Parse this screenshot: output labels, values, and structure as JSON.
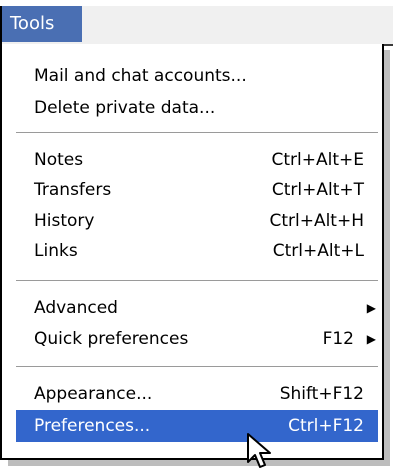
{
  "menubar": {
    "tools_label": "Tools"
  },
  "menu": {
    "items": [
      {
        "label": "Mail and chat accounts...",
        "shortcut": ""
      },
      {
        "label": "Delete private data...",
        "shortcut": ""
      },
      {
        "label": "Notes",
        "shortcut": "Ctrl+Alt+E"
      },
      {
        "label": "Transfers",
        "shortcut": "Ctrl+Alt+T"
      },
      {
        "label": "History",
        "shortcut": "Ctrl+Alt+H"
      },
      {
        "label": "Links",
        "shortcut": "Ctrl+Alt+L"
      },
      {
        "label": "Advanced",
        "shortcut": ""
      },
      {
        "label": "Quick preferences",
        "shortcut": "F12"
      },
      {
        "label": "Appearance...",
        "shortcut": "Shift+F12"
      },
      {
        "label": "Preferences...",
        "shortcut": "Ctrl+F12"
      }
    ],
    "submenu_arrow": "▶",
    "selected_index": 9
  },
  "colors": {
    "menu_title_bg": "#4a6fb3",
    "selection_bg": "#3366cc",
    "selection_text": "#ffffff"
  },
  "icons": {
    "cursor": "arrow-cursor-icon",
    "submenu": "triangle-right-icon"
  }
}
